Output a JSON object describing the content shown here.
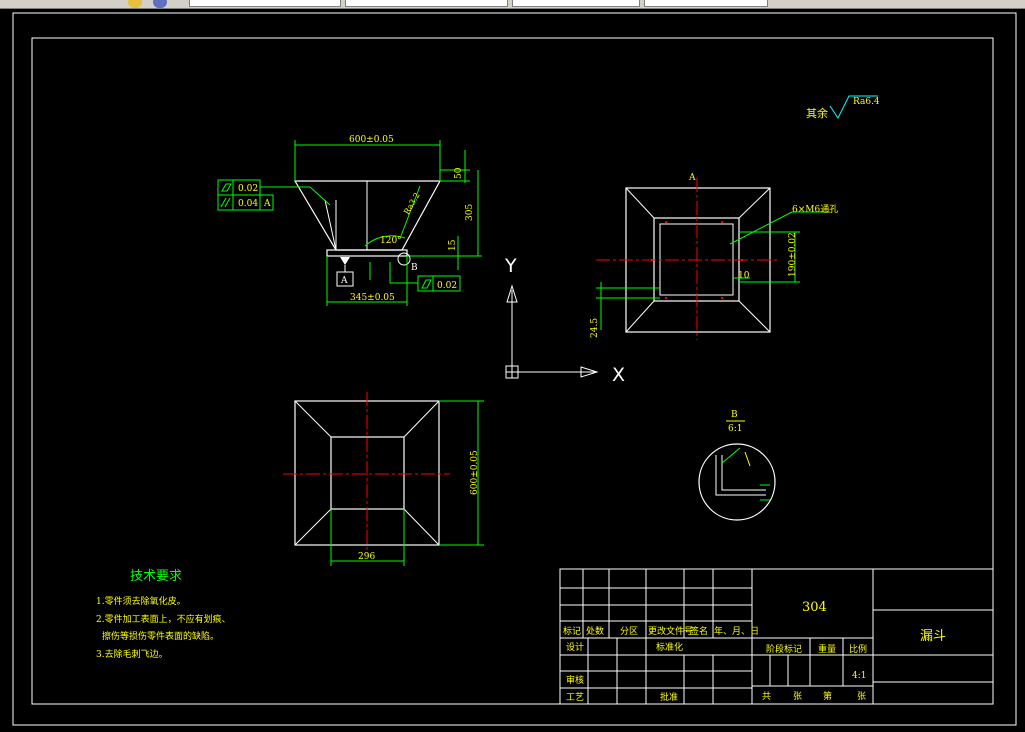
{
  "toolbar": {
    "dropdowns": [
      "",
      "",
      "",
      ""
    ]
  },
  "surface_note": {
    "prefix": "其余",
    "value": "Ra6.4"
  },
  "front_view": {
    "top_width": "600±0.05",
    "bottom_width": "345±0.05",
    "height_total": "305",
    "height_top": "50",
    "height_small": "15",
    "angle": "120°",
    "roughness": "Ra3.2",
    "datum_a": "A",
    "detail_b": "B",
    "flatness": "0.02",
    "parallel": "0.04",
    "parallel_ref": "A",
    "bottom_flatness": "0.02"
  },
  "top_view": {
    "section_mark": "A",
    "holes_note": "6×M6通孔",
    "dim_inner": "190±0.02",
    "dim_10": "10",
    "dim_24": "24.5"
  },
  "plan_view": {
    "dim_width": "600±0.05",
    "dim_inner": "296"
  },
  "ucs": {
    "x": "X",
    "y": "Y"
  },
  "detail": {
    "label": "B",
    "scale": "6:1"
  },
  "tech": {
    "title": "技术要求",
    "lines": [
      "1.零件须去除氧化皮。",
      "2.零件加工表面上，不应有划痕、",
      "擦伤等损伤零件表面的缺陷。",
      "3.去除毛刺飞边。"
    ]
  },
  "title_block": {
    "material": "304",
    "part_name": "漏斗",
    "header": [
      "标记",
      "处数",
      "分区",
      "更改文件号",
      "签名",
      "年、月、日"
    ],
    "design": "设计",
    "standard": "标准化",
    "review": "审核",
    "process": "工艺",
    "approve": "批准",
    "stage": "阶段标记",
    "weight": "重量",
    "ratio": "比例",
    "ratio_value": "4:1",
    "sheets": [
      "共",
      "张",
      "第",
      "张"
    ]
  }
}
